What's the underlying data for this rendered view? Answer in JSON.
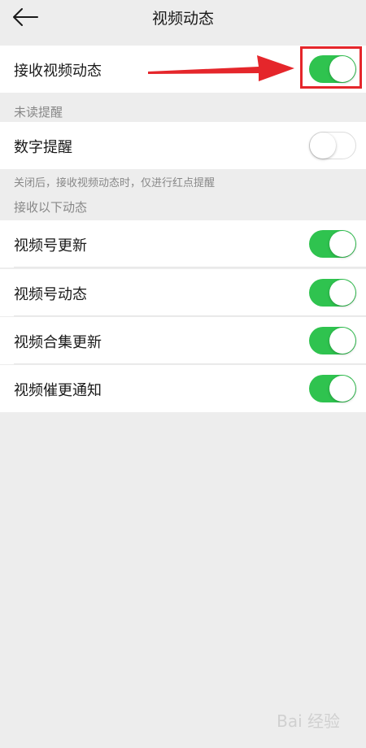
{
  "header": {
    "title": "视频动态",
    "back_icon": "back-arrow-icon"
  },
  "main_toggle": {
    "label": "接收视频动态",
    "on": true
  },
  "unread_section": {
    "title": "未读提醒",
    "items": [
      {
        "label": "数字提醒",
        "on": false
      }
    ],
    "hint": "关闭后，接收视频动态时，仅进行红点提醒"
  },
  "receive_section": {
    "title": "接收以下动态",
    "items": [
      {
        "label": "视频号更新",
        "on": true
      },
      {
        "label": "视频号动态",
        "on": true
      },
      {
        "label": "视频合集更新",
        "on": true
      },
      {
        "label": "视频催更通知",
        "on": true
      }
    ]
  },
  "annotation": {
    "highlight_color": "#e5262b",
    "arrow_icon": "red-arrow-annotation"
  },
  "colors": {
    "toggle_on": "#2fc34f",
    "background": "#ededed"
  },
  "watermark": {
    "text": "Bai 经验"
  }
}
